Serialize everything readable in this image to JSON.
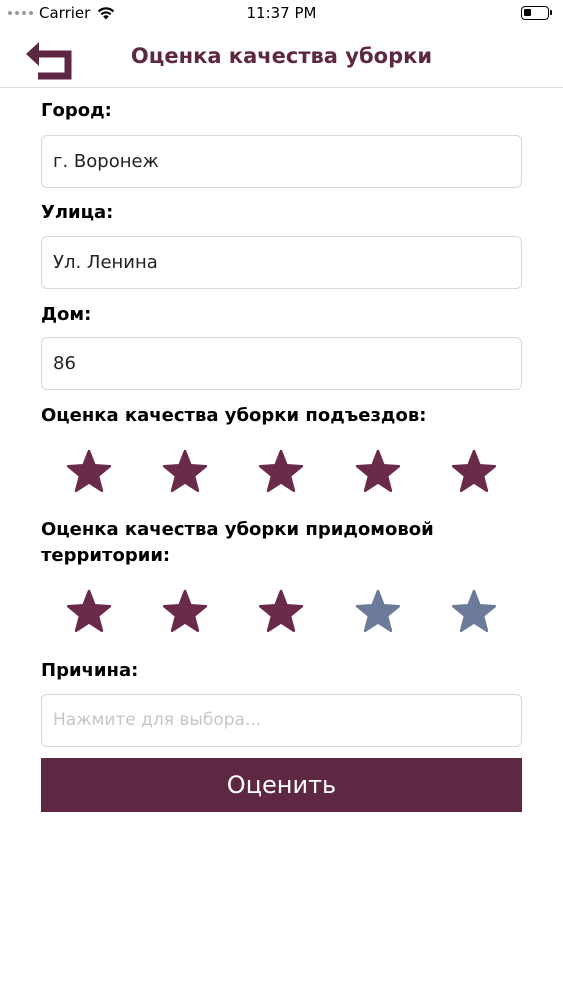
{
  "status_bar": {
    "carrier": "Carrier",
    "time": "11:37 PM"
  },
  "header": {
    "title": "Оценка качества уборки",
    "back_icon": "back-arrow-icon"
  },
  "form": {
    "city": {
      "label": "Город:",
      "value": "г. Воронеж"
    },
    "street": {
      "label": "Улица:",
      "value": "Ул. Ленина"
    },
    "house": {
      "label": "Дом:",
      "value": "86"
    },
    "entrance_rating": {
      "label": "Оценка качества уборки подъездов:",
      "value": 5,
      "max": 5
    },
    "territory_rating": {
      "label_line1": "Оценка качества уборки придомовой",
      "label_line2": "территории:",
      "value": 3,
      "max": 5
    },
    "reason": {
      "label": "Причина:",
      "placeholder": "Нажмите для выбора..."
    },
    "submit_label": "Оценить"
  },
  "colors": {
    "accent": "#5e2843",
    "star_filled": "#6a2a49",
    "star_empty": "#6c7a99"
  }
}
